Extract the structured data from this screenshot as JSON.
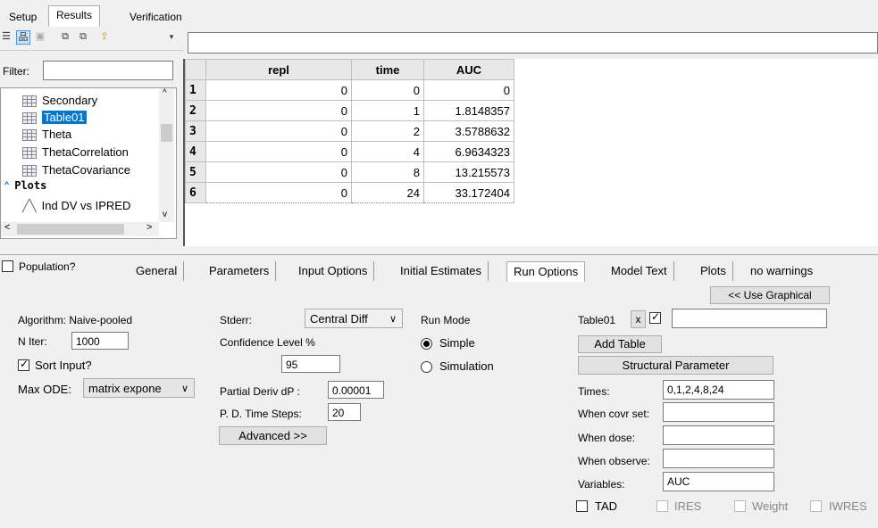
{
  "top_tabs": [
    "Setup",
    "Results",
    "Verification"
  ],
  "filter_label": "Filter:",
  "filter_value": "",
  "tree": {
    "items": [
      "Secondary",
      "Table01",
      "Theta",
      "ThetaCorrelation",
      "ThetaCovariance"
    ],
    "selected": "Table01",
    "group": "Plots",
    "plot_item": "Ind DV vs IPRED"
  },
  "table": {
    "columns": [
      "repl",
      "time",
      "AUC"
    ],
    "rows": [
      [
        "1",
        "0",
        "0",
        "0"
      ],
      [
        "2",
        "0",
        "1",
        "1.8148357"
      ],
      [
        "3",
        "0",
        "2",
        "3.5788632"
      ],
      [
        "4",
        "0",
        "4",
        "6.9634323"
      ],
      [
        "5",
        "0",
        "8",
        "13.215573"
      ],
      [
        "6",
        "0",
        "24",
        "33.172404"
      ]
    ]
  },
  "population_label": "Population?",
  "bottom_tabs": [
    "General",
    "Parameters",
    "Input Options",
    "Initial Estimates",
    "Run Options",
    "Model Text",
    "Plots",
    "no warnings"
  ],
  "active_bottom_tab": "Run Options",
  "run_options": {
    "use_graphical": "<< Use Graphical",
    "algorithm": "Algorithm: Naive-pooled",
    "n_iter_label": "N Iter:",
    "n_iter_value": "1000",
    "sort_input_label": "Sort Input?",
    "sort_input_checked": true,
    "max_ode_label": "Max ODE:",
    "max_ode_value": "matrix expone",
    "stderr_label": "Stderr:",
    "stderr_value": "Central Diff",
    "confidence_label": "Confidence Level %",
    "confidence_value": "95",
    "partial_deriv_label": "Partial Deriv dP :",
    "partial_deriv_value": "0.00001",
    "pd_time_steps_label": "P. D. Time Steps:",
    "pd_time_steps_value": "20",
    "advanced_label": "Advanced >>",
    "run_mode_label": "Run Mode",
    "run_modes": [
      "Simple",
      "Simulation"
    ],
    "selected_run_mode": "Simple",
    "table_name": "Table01",
    "table_x": "x",
    "table_checked": true,
    "table_field": "",
    "add_table": "Add Table",
    "structural_parameter": "Structural Parameter",
    "times_label": "Times:",
    "times_value": "0,1,2,4,8,24",
    "when_covr_label": "When covr set:",
    "when_covr_value": "",
    "when_dose_label": "When dose:",
    "when_dose_value": "",
    "when_observe_label": "When observe:",
    "when_observe_value": "",
    "variables_label": "Variables:",
    "variables_value": "AUC",
    "checks": [
      "TAD",
      "IRES",
      "Weight",
      "IWRES"
    ]
  }
}
